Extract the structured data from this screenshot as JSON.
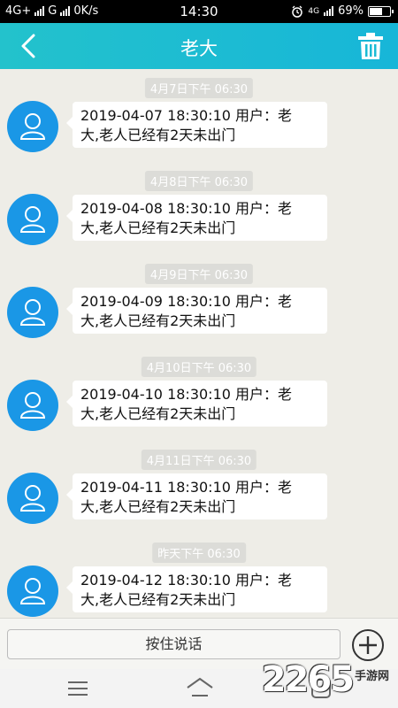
{
  "status_bar": {
    "network_left": "4G+",
    "network_right": "G",
    "speed": "0K/s",
    "time": "14:30",
    "network_4g": "4G",
    "battery": "69%",
    "battery_level": 0.69
  },
  "header": {
    "title": "老大"
  },
  "messages": [
    {
      "time": "4月7日下午 06:30",
      "line1": "2019-04-07 18:30:10 用户：老",
      "line2": "大,老人已经有2天未出门"
    },
    {
      "time": "4月8日下午 06:30",
      "line1": "2019-04-08 18:30:10 用户：老",
      "line2": "大,老人已经有2天未出门"
    },
    {
      "time": "4月9日下午 06:30",
      "line1": "2019-04-09 18:30:10 用户：老",
      "line2": "大,老人已经有2天未出门"
    },
    {
      "time": "4月10日下午 06:30",
      "line1": "2019-04-10 18:30:10 用户：老",
      "line2": "大,老人已经有2天未出门"
    },
    {
      "time": "4月11日下午 06:30",
      "line1": "2019-04-11 18:30:10 用户：老",
      "line2": "大,老人已经有2天未出门"
    },
    {
      "time": "昨天下午 06:30",
      "line1": "2019-04-12 18:30:10 用户：老",
      "line2": "大,老人已经有2天未出门"
    }
  ],
  "input_bar": {
    "voice_label": "按住说话"
  },
  "watermark": {
    "number": "2265",
    "suffix": "手游网"
  },
  "colors": {
    "header_start": "#23c2cc",
    "header_end": "#17b6d8",
    "avatar": "#1a97e6",
    "background": "#eeede7"
  }
}
